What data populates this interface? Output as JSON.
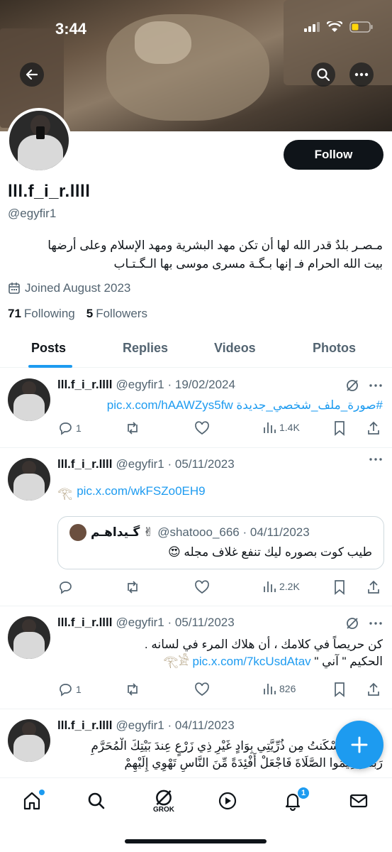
{
  "status_bar": {
    "time": "3:44"
  },
  "profile": {
    "display_name": "lll.f_i_r.llll",
    "handle": "@egyfir1",
    "bio_line1": "مـصـر بلدٌ قدر الله لها أن تكن مهد البشرية ومهد الإسلام وعلى أرضها",
    "bio_line2": "بيت الله الحرام فـ إنها بـگـة مسرى موسى بها الـگـتـاب",
    "joined": "Joined August 2023",
    "following_count": "71",
    "following_label": "Following",
    "followers_count": "5",
    "followers_label": "Followers",
    "follow_button": "Follow"
  },
  "tabs": [
    "Posts",
    "Replies",
    "Videos",
    "Photos"
  ],
  "posts": [
    {
      "name": "lll.f_i_r.llll",
      "meta": "@egyfir1 · 19/02/2024",
      "text": "#صورة_ملف_شخصي_جديدة pic.x.com/hAAWZys5fw",
      "replies": "1",
      "views": "1.4K"
    },
    {
      "name": "lll.f_i_r.llll",
      "meta": "@egyfir1 · 05/11/2023",
      "text": "pic.x.com/wkFSZo0EH9",
      "quote": {
        "name": "گـيداهـم ✌",
        "meta": "@shatooo_666 · 04/11/2023",
        "text": "طيب كوت بصوره ليك تنفع غلاف مجله 😍"
      },
      "views": "2.2K"
    },
    {
      "name": "lll.f_i_r.llll",
      "meta": "@egyfir1 · 05/11/2023",
      "line1": "كن حريصاً في كلامك ، أن هلاك المرء في لسانه .",
      "line2_prefix": "الحكيم \" آني \"",
      "line2_link": "pic.x.com/7kcUsdAtav",
      "replies": "1",
      "views": "826"
    },
    {
      "name": "lll.f_i_r.llll",
      "meta": "@egyfir1 · 04/11/2023",
      "line1": "رَبَّنَا إِنِّي أَسْكَنتُ مِن ذُرِّيَّتِي بِوَادٍ غَيْرِ ذِي زَرْعٍ عِندَ بَيْتِكَ الْمُحَرَّمِ",
      "line2": "رَبَّنَا لِيُقِيمُوا الصَّلَاةَ فَاجْعَلْ أَفْئِدَةً مِّنَ النَّاسِ تَهْوِي إِلَيْهِمْ"
    }
  ],
  "nav": {
    "grok_label": "GROK",
    "notifications_badge": "1"
  }
}
